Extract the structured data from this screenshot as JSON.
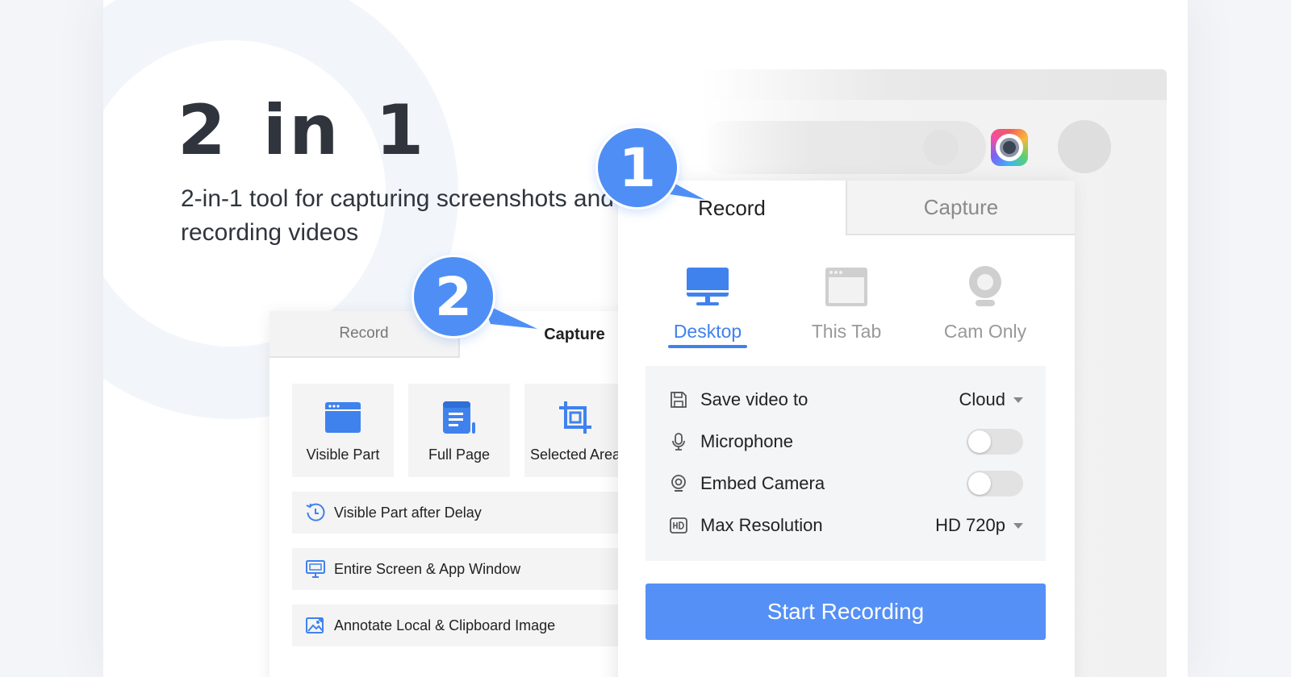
{
  "hero": {
    "title": "2 in 1",
    "subtitle": "2-in-1 tool for capturing screenshots and recording videos"
  },
  "badges": {
    "record": "1",
    "capture": "2"
  },
  "colors": {
    "accent": "#3f82ee",
    "button": "#5590f6",
    "badge": "#4f8ff5"
  },
  "capture_panel": {
    "tabs": {
      "record": "Record",
      "capture": "Capture"
    },
    "tiles": [
      {
        "label": "Visible Part",
        "icon": "browser-window-icon"
      },
      {
        "label": "Full Page",
        "icon": "scroll-page-icon"
      },
      {
        "label": "Selected Area",
        "icon": "crop-icon"
      }
    ],
    "rows": [
      {
        "label": "Visible Part after Delay",
        "icon": "clock-delay-icon"
      },
      {
        "label": "Entire Screen & App Window",
        "icon": "monitor-icon"
      },
      {
        "label": "Annotate Local & Clipboard Image",
        "icon": "image-icon"
      }
    ]
  },
  "record_panel": {
    "tabs": {
      "record": "Record",
      "capture": "Capture"
    },
    "modes": [
      {
        "label": "Desktop",
        "icon": "desktop-icon",
        "active": true
      },
      {
        "label": "This Tab",
        "icon": "browser-tab-icon",
        "active": false
      },
      {
        "label": "Cam Only",
        "icon": "webcam-icon",
        "active": false
      }
    ],
    "settings": {
      "save": {
        "label": "Save video to",
        "value": "Cloud"
      },
      "microphone": {
        "label": "Microphone",
        "enabled": false
      },
      "camera": {
        "label": "Embed Camera",
        "enabled": false
      },
      "resolution": {
        "label": "Max Resolution",
        "value": "HD 720p"
      }
    },
    "start_button": "Start Recording"
  }
}
